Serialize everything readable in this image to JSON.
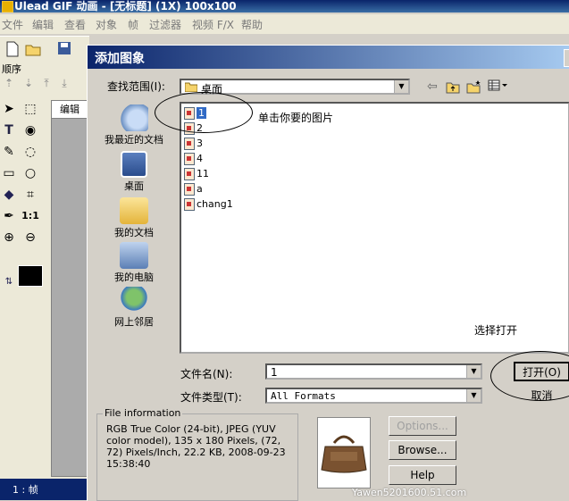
{
  "app": {
    "title": "Ulead GIF 动画 - [无标题] (1X) 100x100",
    "menu": [
      "文件",
      "编辑",
      "查看",
      "对象",
      "帧",
      "过滤器",
      "视频 F/X",
      "帮助"
    ],
    "order_label": "顺序",
    "edit_tab": "编辑",
    "frame_label": "1 : 帧"
  },
  "dialog": {
    "title": "添加图象",
    "look_in_label": "查找范围(I):",
    "look_in_value": "桌面",
    "places": [
      "我最近的文档",
      "桌面",
      "我的文档",
      "我的电脑",
      "网上邻居"
    ],
    "files": [
      "1",
      "2",
      "3",
      "4",
      "11",
      "a",
      "chang1"
    ],
    "selected_file": "1",
    "annotation_click": "单击你要的图片",
    "annotation_open": "选择打开",
    "filename_label": "文件名(N):",
    "filename_value": "1",
    "filetype_label": "文件类型(T):",
    "filetype_value": "All Formats",
    "open_button": "打开(O)",
    "cancel_button": "取消",
    "options_button": "Options...",
    "browse_button": "Browse...",
    "help_button": "Help",
    "info_legend": "File information",
    "info_text": "RGB True Color (24-bit), JPEG (YUV color model), 135 x 180 Pixels, (72, 72) Pixels/Inch, 22.2 KB, 2008-09-23 15:38:40"
  },
  "watermark": "Yawen5201600.51.com"
}
